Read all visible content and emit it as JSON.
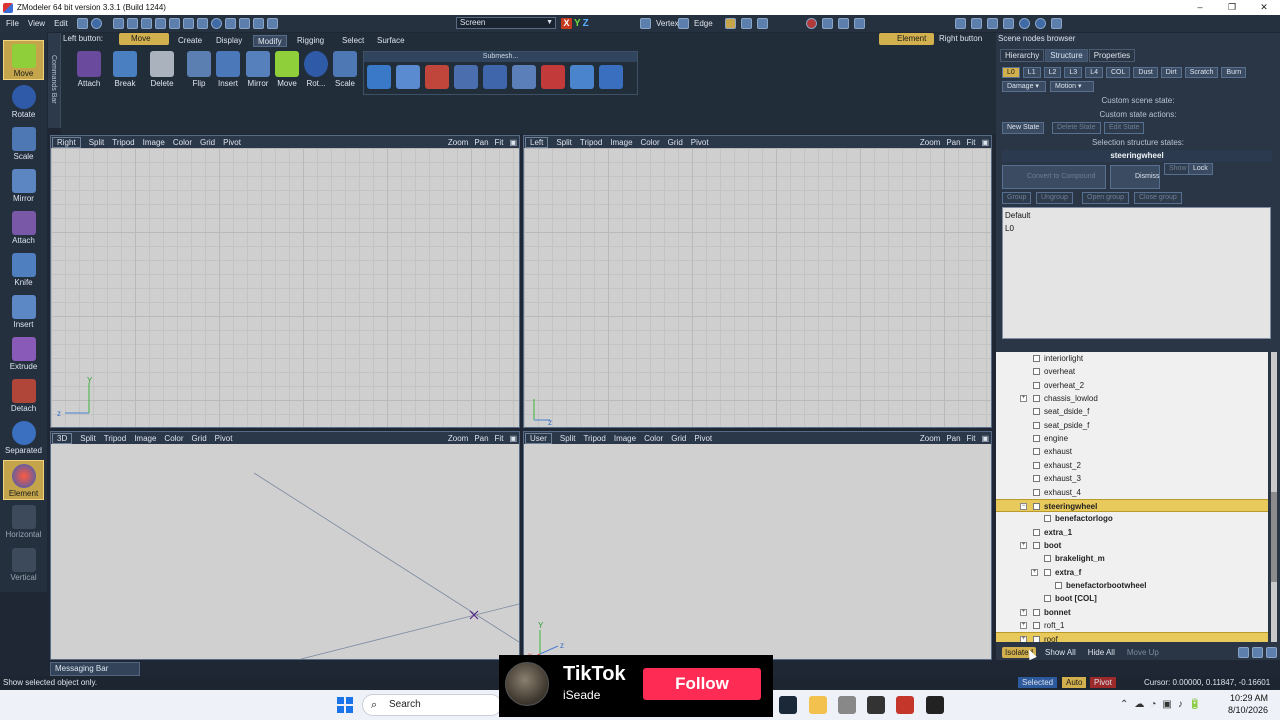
{
  "window": {
    "title": "ZModeler 64 bit version 3.3.1 (Build 1244)"
  },
  "menubar": {
    "menus": [
      "File",
      "View",
      "Edit"
    ],
    "mode_select": "Screen",
    "vertex_label": "Vertex",
    "edge_label": "Edge"
  },
  "left_tools": [
    {
      "label": "Move",
      "icon": "move-icon",
      "active": true
    },
    {
      "label": "Rotate",
      "icon": "rotate-icon",
      "active": false
    },
    {
      "label": "Scale",
      "icon": "scale-icon",
      "active": false
    },
    {
      "label": "Mirror",
      "icon": "mirror-icon",
      "active": false
    },
    {
      "label": "Attach",
      "icon": "attach-icon",
      "active": false
    },
    {
      "label": "Knife",
      "icon": "knife-icon",
      "active": false
    },
    {
      "label": "Insert",
      "icon": "insert-icon",
      "active": false
    },
    {
      "label": "Extrude",
      "icon": "extrude-icon",
      "active": false
    },
    {
      "label": "Detach",
      "icon": "detach-icon",
      "active": false
    },
    {
      "label": "Separated",
      "icon": "separated-icon",
      "active": false
    },
    {
      "label": "Element",
      "icon": "element-icon",
      "active": true
    },
    {
      "label": "Horizontal",
      "icon": "horizontal-icon",
      "active": false
    },
    {
      "label": "Vertical",
      "icon": "vertical-icon",
      "active": false
    }
  ],
  "commands_bar_label": "Commands Bar",
  "ribbon": {
    "left_button_label": "Left button:",
    "left_button_value": "Move",
    "tabs": [
      "Create",
      "Display",
      "Modify",
      "Rigging",
      "Select",
      "Surface"
    ],
    "active_tab": "Modify",
    "element_chip": "Element",
    "right_button_label": "Right button",
    "tools": [
      "Attach",
      "Break",
      "Delete",
      "Flip",
      "Insert",
      "Mirror",
      "Move",
      "Rot...",
      "Scale"
    ],
    "submesh_label": "Submesh..."
  },
  "viewports": [
    {
      "name": "Right",
      "items": [
        "Split",
        "Tripod",
        "Image",
        "Color",
        "Grid",
        "Pivot"
      ],
      "controls": [
        "Zoom",
        "Pan",
        "Fit"
      ]
    },
    {
      "name": "Left",
      "items": [
        "Split",
        "Tripod",
        "Image",
        "Color",
        "Grid",
        "Pivot"
      ],
      "controls": [
        "Zoom",
        "Pan",
        "Fit"
      ]
    },
    {
      "name": "3D",
      "items": [
        "Split",
        "Tripod",
        "Image",
        "Color",
        "Grid",
        "Pivot"
      ],
      "controls": [
        "Zoom",
        "Pan",
        "Fit"
      ]
    },
    {
      "name": "User",
      "items": [
        "Split",
        "Tripod",
        "Image",
        "Color",
        "Grid",
        "Pivot"
      ],
      "controls": [
        "Zoom",
        "Pan",
        "Fit"
      ]
    }
  ],
  "axes": {
    "x": "x",
    "y": "Y",
    "z": "z"
  },
  "scene_browser": {
    "title": "Scene nodes browser",
    "tabs": [
      "Hierarchy",
      "Structure",
      "Properties"
    ],
    "active_tab": "Structure",
    "lods": [
      "L0",
      "L1",
      "L2",
      "L3",
      "L4",
      "COL",
      "Dust",
      "Dirt",
      "Scratch",
      "Burn"
    ],
    "damage": "Damage",
    "motion": "Motion",
    "custom_scene_state": "Custom scene state:",
    "custom_state_actions": "Custom state actions:",
    "new_state": "New State",
    "delete_state": "Delete State",
    "edit_state": "Edit State",
    "selection_structure_states": "Selection structure states:",
    "selected_node": "steeringwheel",
    "convert_compound": "Convert to Compound",
    "dismiss": "Dismiss",
    "show": "Show",
    "lock": "Lock",
    "group": "Group",
    "ungroup": "Ungroup",
    "open_group": "Open group",
    "close_group": "Close group",
    "states": [
      "Default",
      "L0"
    ]
  },
  "tree": [
    {
      "label": "interiorlight",
      "indent": 0,
      "exp": false,
      "bold": false,
      "sel": false
    },
    {
      "label": "overheat",
      "indent": 0,
      "exp": false,
      "bold": false,
      "sel": false
    },
    {
      "label": "overheat_2",
      "indent": 0,
      "exp": false,
      "bold": false,
      "sel": false
    },
    {
      "label": "chassis_lowlod",
      "indent": 0,
      "exp": true,
      "bold": false,
      "sel": false
    },
    {
      "label": "seat_dside_f",
      "indent": 0,
      "exp": false,
      "bold": false,
      "sel": false
    },
    {
      "label": "seat_pside_f",
      "indent": 0,
      "exp": false,
      "bold": false,
      "sel": false
    },
    {
      "label": "engine",
      "indent": 0,
      "exp": false,
      "bold": false,
      "sel": false
    },
    {
      "label": "exhaust",
      "indent": 0,
      "exp": false,
      "bold": false,
      "sel": false
    },
    {
      "label": "exhaust_2",
      "indent": 0,
      "exp": false,
      "bold": false,
      "sel": false
    },
    {
      "label": "exhaust_3",
      "indent": 0,
      "exp": false,
      "bold": false,
      "sel": false
    },
    {
      "label": "exhaust_4",
      "indent": 0,
      "exp": false,
      "bold": false,
      "sel": false
    },
    {
      "label": "steeringwheel",
      "indent": 0,
      "exp": true,
      "bold": true,
      "sel": true
    },
    {
      "label": "benefactorlogo",
      "indent": 1,
      "exp": false,
      "bold": true,
      "sel": false
    },
    {
      "label": "extra_1",
      "indent": 0,
      "exp": false,
      "bold": true,
      "sel": false
    },
    {
      "label": "boot",
      "indent": 0,
      "exp": true,
      "bold": true,
      "sel": false
    },
    {
      "label": "brakelight_m",
      "indent": 1,
      "exp": false,
      "bold": true,
      "sel": false
    },
    {
      "label": "extra_f",
      "indent": 1,
      "exp": true,
      "bold": true,
      "sel": false
    },
    {
      "label": "benefactorbootwheel",
      "indent": 2,
      "exp": false,
      "bold": true,
      "sel": false
    },
    {
      "label": "boot [COL]",
      "indent": 1,
      "exp": false,
      "bold": true,
      "sel": false
    },
    {
      "label": "bonnet",
      "indent": 0,
      "exp": true,
      "bold": true,
      "sel": false
    },
    {
      "label": "roft_1",
      "indent": 0,
      "exp": true,
      "bold": false,
      "sel": false
    },
    {
      "label": "roof",
      "indent": 0,
      "exp": true,
      "bold": false,
      "sel": true
    }
  ],
  "tree_bottom": {
    "isolated": "Isolated",
    "show_all": "Show All",
    "hide_all": "Hide All",
    "move_up": "Move Up"
  },
  "messaging_bar": "Messaging Bar",
  "status": {
    "text": "Show selected object only.",
    "selected": "Selected",
    "auto": "Auto",
    "pivot": "Pivot",
    "cursor": "Cursor: 0.00000, 0.11847, -0.16601"
  },
  "tiktok": {
    "brand": "TikTok",
    "user": "iSeade",
    "follow": "Follow"
  },
  "taskbar": {
    "search": "Search",
    "time": "10:29 AM",
    "date": "8/10/2026"
  },
  "window_controls": [
    "–",
    "❐",
    "✕"
  ],
  "colors": {
    "accent_gold": "#d2b04e",
    "panel_bg": "#2a3645",
    "viewport_bg": "#cfcfcf",
    "tiktok_red": "#fe2c55"
  }
}
